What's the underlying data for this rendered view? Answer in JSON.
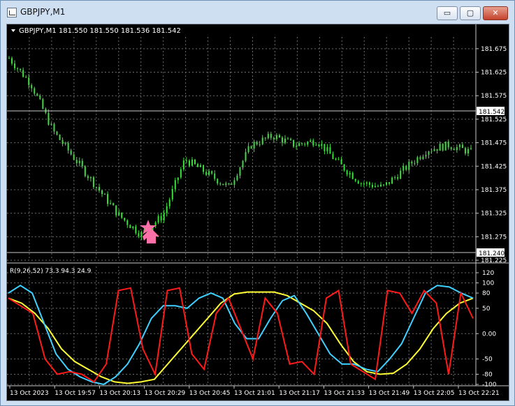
{
  "window": {
    "title": "GBPJPY,M1",
    "minimize_label": "▭",
    "maximize_label": "▢",
    "close_label": "✕"
  },
  "price_chart": {
    "header": "GBPJPY,M1  181.550 181.550 181.536 181.542",
    "current_price": "181.542",
    "low_line_price": "181.240",
    "y_ticks": [
      "181.675",
      "181.625",
      "181.575",
      "181.525",
      "181.475",
      "181.425",
      "181.375",
      "181.325",
      "181.275",
      "181.225"
    ],
    "candle_color": "#3fdc3f",
    "arrow_color": "#ff6fa8"
  },
  "indicator": {
    "header": "R(9,26,52) 73.3 94.3 24.9",
    "y_ticks": [
      "120",
      "100",
      "80",
      "50",
      "0.00",
      "-50",
      "-80",
      "-100"
    ],
    "colors": {
      "fast": "#ff1a1a",
      "mid": "#3fd0ff",
      "slow": "#ffff33"
    }
  },
  "x_axis": {
    "labels": [
      "13 Oct 2023",
      "13 Oct 19:57",
      "13 Oct 20:13",
      "13 Oct 20:29",
      "13 Oct 20:45",
      "13 Oct 21:01",
      "13 Oct 21:17",
      "13 Oct 21:33",
      "13 Oct 21:49",
      "13 Oct 22:05",
      "13 Oct 22:21"
    ]
  },
  "chart_data": {
    "type": "line",
    "title": "GBPJPY,M1",
    "xlabel": "",
    "ylabel": "",
    "ylim": [
      181.225,
      181.7
    ],
    "categories": [
      "13 Oct 2023",
      "13 Oct 19:57",
      "13 Oct 20:13",
      "13 Oct 20:29",
      "13 Oct 20:45",
      "13 Oct 21:01",
      "13 Oct 21:17",
      "13 Oct 21:33",
      "13 Oct 21:49",
      "13 Oct 22:05",
      "13 Oct 22:21"
    ],
    "series": [
      {
        "values": [
          181.655,
          181.6,
          181.5,
          181.44,
          181.38,
          181.32,
          181.28,
          181.32,
          181.44,
          181.41,
          181.38,
          181.47,
          181.49,
          181.47,
          181.48,
          181.43,
          181.39,
          181.38,
          181.42,
          181.46,
          181.47,
          181.455
        ]
      }
    ],
    "indicator": {
      "ylim": [
        -100,
        120
      ],
      "fast": [
        70,
        55,
        40,
        -50,
        -80,
        -75,
        -80,
        -95,
        -60,
        85,
        90,
        -30,
        -80,
        85,
        90,
        -40,
        -70,
        40,
        70,
        10,
        -50,
        70,
        40,
        -60,
        -55,
        -80,
        70,
        85,
        -60,
        -75,
        -90,
        85,
        80,
        40,
        85,
        60,
        -80,
        80,
        30
      ],
      "mid": [
        80,
        95,
        80,
        20,
        -40,
        -70,
        -85,
        -95,
        -100,
        -85,
        -60,
        -20,
        30,
        55,
        55,
        50,
        70,
        80,
        70,
        20,
        -10,
        -10,
        30,
        65,
        75,
        40,
        0,
        -40,
        -60,
        -60,
        -70,
        -75,
        -50,
        -20,
        30,
        80,
        95,
        92,
        80,
        70
      ],
      "slow": [
        70,
        60,
        40,
        10,
        -30,
        -55,
        -70,
        -85,
        -95,
        -98,
        -95,
        -90,
        -60,
        -30,
        0,
        30,
        60,
        78,
        82,
        82,
        82,
        75,
        60,
        45,
        20,
        -20,
        -55,
        -75,
        -80,
        -78,
        -60,
        -30,
        10,
        40,
        60,
        70
      ]
    }
  }
}
